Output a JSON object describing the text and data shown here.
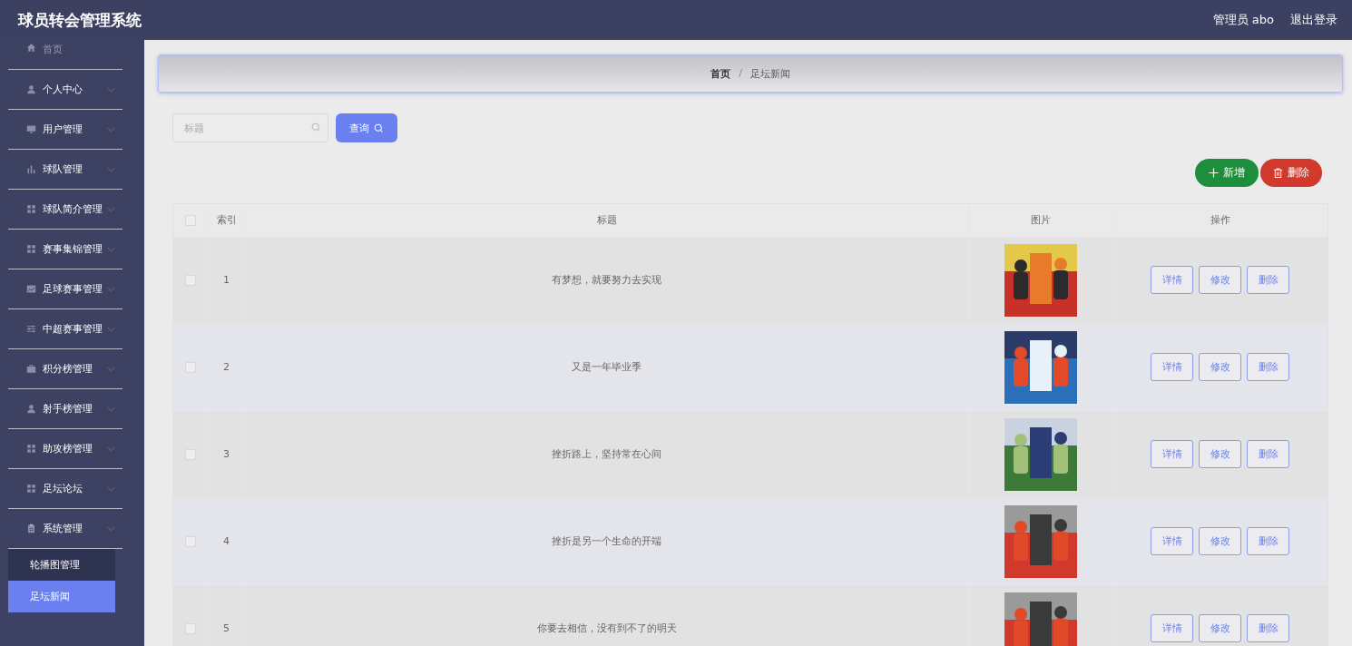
{
  "app_title": "球员转会管理系统",
  "header": {
    "user": "管理员 abo",
    "logout": "退出登录"
  },
  "sidebar": {
    "items": [
      {
        "label": "首页",
        "kind": "link"
      },
      {
        "label": "个人中心",
        "kind": "submenu"
      },
      {
        "label": "用户管理",
        "kind": "submenu"
      },
      {
        "label": "球队管理",
        "kind": "submenu"
      },
      {
        "label": "球队简介管理",
        "kind": "submenu"
      },
      {
        "label": "赛事集锦管理",
        "kind": "submenu"
      },
      {
        "label": "足球赛事管理",
        "kind": "submenu"
      },
      {
        "label": "中超赛事管理",
        "kind": "submenu"
      },
      {
        "label": "积分榜管理",
        "kind": "submenu"
      },
      {
        "label": "射手榜管理",
        "kind": "submenu"
      },
      {
        "label": "助攻榜管理",
        "kind": "submenu"
      },
      {
        "label": "足坛论坛",
        "kind": "submenu"
      },
      {
        "label": "系统管理",
        "kind": "submenu",
        "children": [
          {
            "label": "轮播图管理",
            "selected": false
          },
          {
            "label": "足坛新闻",
            "selected": true
          }
        ]
      }
    ]
  },
  "breadcrumb": {
    "items": [
      "首页",
      "足坛新闻"
    ],
    "separator": "/"
  },
  "search": {
    "placeholder": "标题",
    "button": "查询"
  },
  "actions": {
    "add": "新增",
    "delete": "删除"
  },
  "table": {
    "header_checked": false,
    "columns": [
      "索引",
      "标题",
      "图片",
      "操作"
    ],
    "rows": [
      {
        "checked": false,
        "index": "1",
        "title": "有梦想，就要努力去实现",
        "buttons": [
          "详情",
          "修改",
          "删除"
        ]
      },
      {
        "checked": false,
        "index": "2",
        "title": "又是一年毕业季",
        "buttons": [
          "详情",
          "修改",
          "删除"
        ]
      },
      {
        "checked": false,
        "index": "3",
        "title": "挫折路上，坚持常在心间",
        "buttons": [
          "详情",
          "修改",
          "删除"
        ]
      },
      {
        "checked": false,
        "index": "4",
        "title": "挫折是另一个生命的开端",
        "buttons": [
          "详情",
          "修改",
          "删除"
        ]
      },
      {
        "checked": false,
        "index": "5",
        "title": "你要去相信，没有到不了的明天",
        "buttons": [
          "详情",
          "修改",
          "删除"
        ]
      }
    ]
  }
}
